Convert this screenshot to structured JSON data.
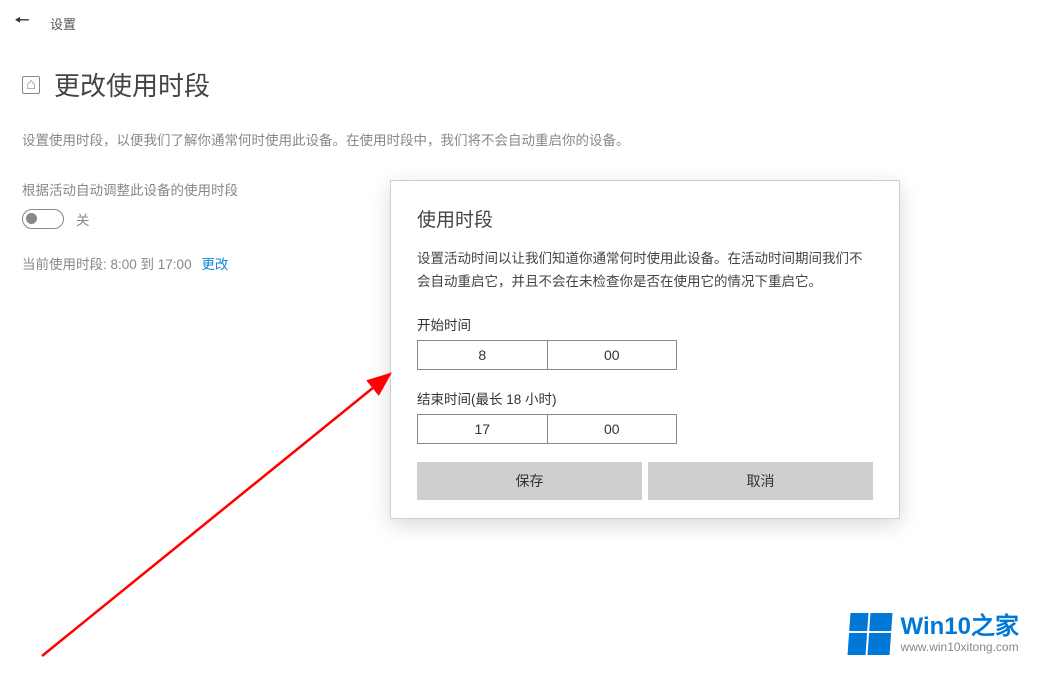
{
  "header": {
    "title": "设置"
  },
  "page": {
    "title": "更改使用时段",
    "description": "设置使用时段，以便我们了解你通常何时使用此设备。在使用时段中，我们将不会自动重启你的设备。",
    "auto_adjust_label": "根据活动自动调整此设备的使用时段",
    "toggle_state": "关",
    "current_hours_prefix": "当前使用时段: ",
    "current_hours_value": "8:00 到 17:00",
    "change_link": "更改"
  },
  "dialog": {
    "title": "使用时段",
    "description": "设置活动时间以让我们知道你通常何时使用此设备。在活动时间期间我们不会自动重启它，并且不会在未检查你是否在使用它的情况下重启它。",
    "start_label": "开始时间",
    "start_hour": "8",
    "start_minute": "00",
    "end_label": "结束时间(最长 18 小时)",
    "end_hour": "17",
    "end_minute": "00",
    "save_label": "保存",
    "cancel_label": "取消"
  },
  "watermark": {
    "brand_prefix": "Win10",
    "brand_suffix": "之家",
    "url": "www.win10xitong.com"
  }
}
